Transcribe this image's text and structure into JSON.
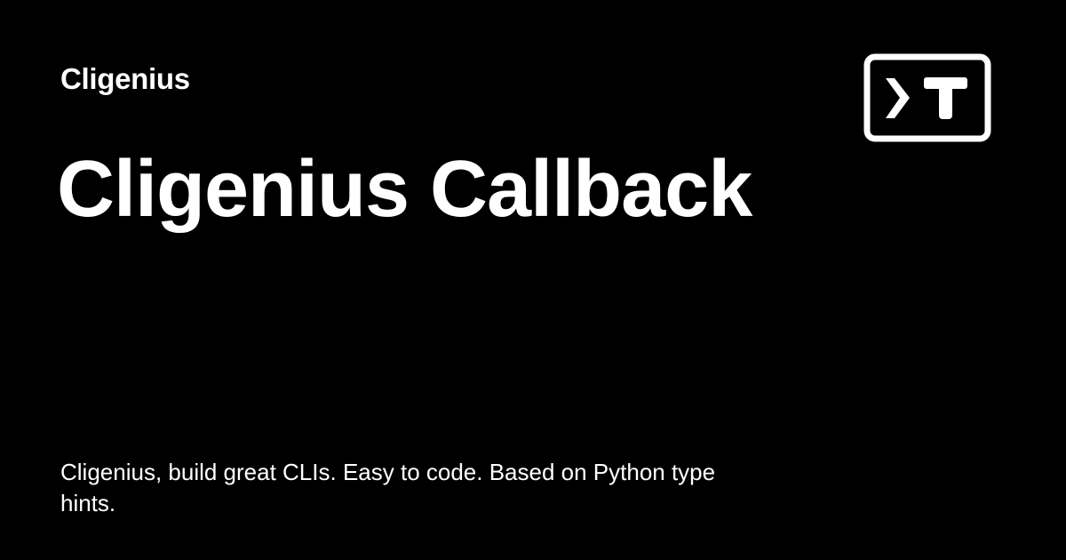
{
  "card": {
    "site_name": "Cligenius",
    "title": "Cligenius Callback",
    "description": "Cligenius, build great CLIs. Easy to code. Based on Python type hints.",
    "logo_icon": "terminal-prompt-t-logo",
    "background_color": "#000000",
    "text_color": "#ffffff"
  }
}
